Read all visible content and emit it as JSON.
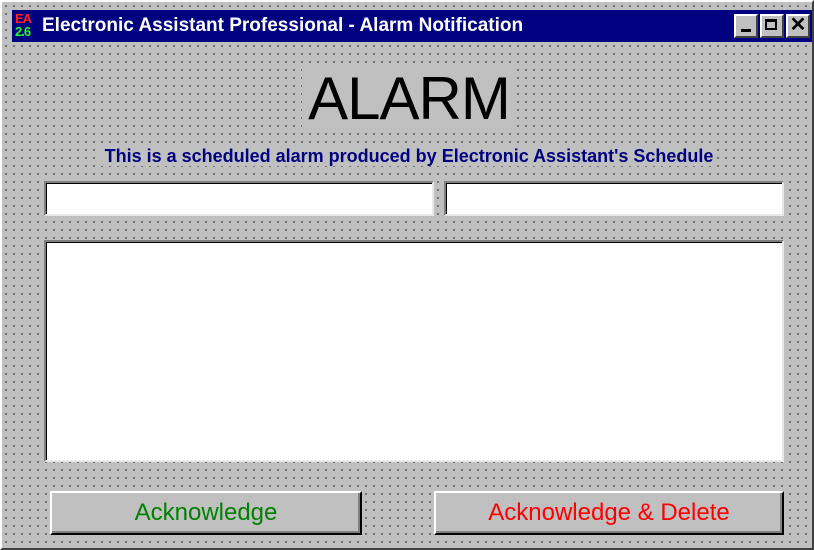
{
  "window": {
    "title": "Electronic Assistant  Professional - Alarm Notification",
    "icon_top": "EA",
    "icon_bottom": "2.6"
  },
  "icons": {
    "app": "app-logo-icon",
    "minimize": "minimize-icon",
    "maximize": "maximize-icon",
    "close": "close-icon",
    "close_glyph": "✕"
  },
  "main": {
    "heading": "ALARM",
    "subtitle": "This is a scheduled alarm produced by Electronic Assistant's Schedule",
    "field_left_value": "",
    "field_right_value": "",
    "message_value": ""
  },
  "buttons": {
    "acknowledge": "Acknowledge",
    "acknowledge_delete": "Acknowledge & Delete"
  },
  "colors": {
    "titlebar": "#000080",
    "subtitle": "#000080",
    "acknowledge": "#008000",
    "acknowledge_delete": "#ff0000",
    "background": "#c0c0c0"
  }
}
